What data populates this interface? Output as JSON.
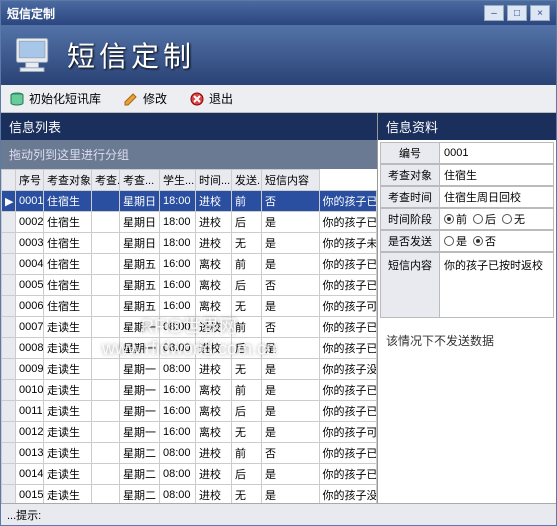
{
  "window": {
    "title": "短信定制"
  },
  "titlebar_buttons": {
    "min": "–",
    "restore": "□",
    "close": "×"
  },
  "banner": {
    "title": "短信定制"
  },
  "toolbar": {
    "init_label": "初始化短讯库",
    "edit_label": "修改",
    "exit_label": "退出"
  },
  "left": {
    "header": "信息列表",
    "group_hint": "拖动列到这里进行分组",
    "columns": [
      "序号",
      "考查对象",
      "考查...",
      "考查...",
      "学生...",
      "时间...",
      "发送...",
      "短信内容"
    ],
    "rows": [
      {
        "no": "0001",
        "obj": "住宿生",
        "c3": "",
        "day": "星期日",
        "time": "18:00",
        "stu": "进校",
        "phase": "前",
        "send": "否",
        "content": "你的孩子已按时返",
        "sel": true
      },
      {
        "no": "0002",
        "obj": "住宿生",
        "c3": "",
        "day": "星期日",
        "time": "18:00",
        "stu": "进校",
        "phase": "后",
        "send": "是",
        "content": "你的孩子已按时"
      },
      {
        "no": "0003",
        "obj": "住宿生",
        "c3": "",
        "day": "星期日",
        "time": "18:00",
        "stu": "进校",
        "phase": "无",
        "send": "是",
        "content": "你的孩子未能准时"
      },
      {
        "no": "0004",
        "obj": "住宿生",
        "c3": "",
        "day": "星期五",
        "time": "16:00",
        "stu": "离校",
        "phase": "前",
        "send": "是",
        "content": "你的孩子已按时"
      },
      {
        "no": "0005",
        "obj": "住宿生",
        "c3": "",
        "day": "星期五",
        "time": "16:00",
        "stu": "离校",
        "phase": "后",
        "send": "否",
        "content": "你的孩子已离校"
      },
      {
        "no": "0006",
        "obj": "住宿生",
        "c3": "",
        "day": "星期五",
        "time": "16:00",
        "stu": "离校",
        "phase": "无",
        "send": "是",
        "content": "你的孩子可能尚未"
      },
      {
        "no": "0007",
        "obj": "走读生",
        "c3": "",
        "day": "星期一",
        "time": "08:00",
        "stu": "进校",
        "phase": "前",
        "send": "否",
        "content": "你的孩子已按时"
      },
      {
        "no": "0008",
        "obj": "走读生",
        "c3": "",
        "day": "星期一",
        "time": "08:00",
        "stu": "进校",
        "phase": "后",
        "send": "是",
        "content": "你的孩子已按时"
      },
      {
        "no": "0009",
        "obj": "走读生",
        "c3": "",
        "day": "星期一",
        "time": "08:00",
        "stu": "进校",
        "phase": "无",
        "send": "是",
        "content": "你的孩子没有准"
      },
      {
        "no": "0010",
        "obj": "走读生",
        "c3": "",
        "day": "星期一",
        "time": "16:00",
        "stu": "离校",
        "phase": "前",
        "send": "是",
        "content": "你的孩子已按时"
      },
      {
        "no": "0011",
        "obj": "走读生",
        "c3": "",
        "day": "星期一",
        "time": "16:00",
        "stu": "离校",
        "phase": "后",
        "send": "是",
        "content": "你的孩子已离校"
      },
      {
        "no": "0012",
        "obj": "走读生",
        "c3": "",
        "day": "星期一",
        "time": "16:00",
        "stu": "离校",
        "phase": "无",
        "send": "是",
        "content": "你的孩子可能尚"
      },
      {
        "no": "0013",
        "obj": "走读生",
        "c3": "",
        "day": "星期二",
        "time": "08:00",
        "stu": "进校",
        "phase": "前",
        "send": "否",
        "content": "你的孩子已按时"
      },
      {
        "no": "0014",
        "obj": "走读生",
        "c3": "",
        "day": "星期二",
        "time": "08:00",
        "stu": "进校",
        "phase": "后",
        "send": "是",
        "content": "你的孩子已按时"
      },
      {
        "no": "0015",
        "obj": "走读生",
        "c3": "",
        "day": "星期二",
        "time": "08:00",
        "stu": "进校",
        "phase": "无",
        "send": "是",
        "content": "你的孩子没有准"
      }
    ]
  },
  "right": {
    "header": "信息资料",
    "fields": {
      "no_label": "编号",
      "no_value": "0001",
      "obj_label": "考查对象",
      "obj_value": "住宿生",
      "time_label": "考查时间",
      "time_value": "住宿生周日回校",
      "phase_label": "时间阶段",
      "phase_options": {
        "before": "前",
        "after": "后",
        "none": "无"
      },
      "send_label": "是否发送",
      "send_options": {
        "yes": "是",
        "no": "否"
      },
      "content_label": "短信内容",
      "content_value": "你的孩子已按时返校"
    },
    "status_note": "该情况下不发送数据"
  },
  "statusbar": {
    "hint": "...提示:"
  },
  "watermark": {
    "line1": "RFID世界网",
    "line2": "www.rfidworld.com.cn"
  }
}
